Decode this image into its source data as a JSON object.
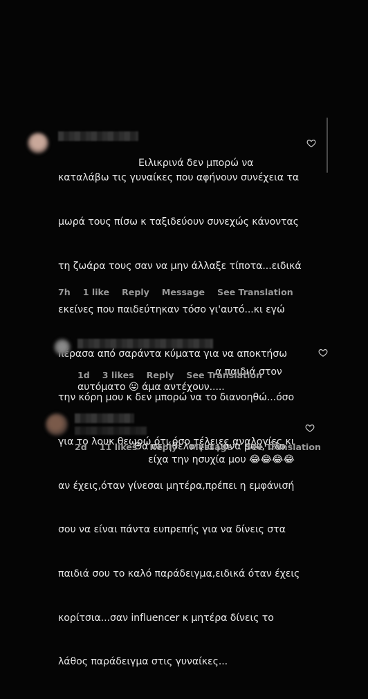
{
  "comments": [
    {
      "username": "",
      "lines": [
        "Ειλικρινά δεν μπορώ να",
        "καταλάβω τις γυναίκες που αφήνουν συνέχεια τα",
        "μωρά τους πίσω κ ταξιδεύουν συνεχώς κάνοντας",
        "τη ζωάρα τους σαν να μην άλλαξε τίποτα...ειδικά",
        "εκείνες που παιδεύτηκαν τόσο γι'αυτό...κι εγώ",
        "πέρασα από σαράντα κύματα για να αποκτήσω",
        "την κόρη μου κ δεν μπορώ να το διανοηθώ...όσο",
        "για το λουκ θεωρώ ότι όσο τέλειες αναλογίες κι",
        "αν έχεις,όταν γίνεσαι μητέρα,πρέπει η εμφάνισή",
        "σου να είναι πάντα ευπρεπής για να δίνεις στα",
        "παιδιά σου το καλό παράδειγμα,ειδικά όταν έχεις",
        "κορίτσια...σαν influencer κ μητέρα δίνεις το",
        "λάθος παράδειγμα στις γυναίκες..."
      ],
      "time": "7h",
      "likes": "1 like",
      "reply": "Reply",
      "message": "Message",
      "translate": "See Translation"
    },
    {
      "username": "",
      "lines": [
        "α παιδιά στον",
        "αυτόματο 😛 άμα αντέχουν....."
      ],
      "time": "1d",
      "likes": "3 likes",
      "reply": "Reply",
      "translate": "See Translation"
    },
    {
      "username": "",
      "lines": [
        "Θα σε ήθελα για μάνα μου, όλο",
        "είχα την ησυχία μου 😂😂😂😂"
      ],
      "time": "2d",
      "likes": "11 likes",
      "reply": "Reply",
      "message": "Message",
      "translate": "See Translation"
    }
  ],
  "icons": {
    "like": "heart-outline-icon"
  },
  "colors": {
    "background": "#050505",
    "text": "#e6e6e6",
    "meta": "#9a9a9a"
  }
}
